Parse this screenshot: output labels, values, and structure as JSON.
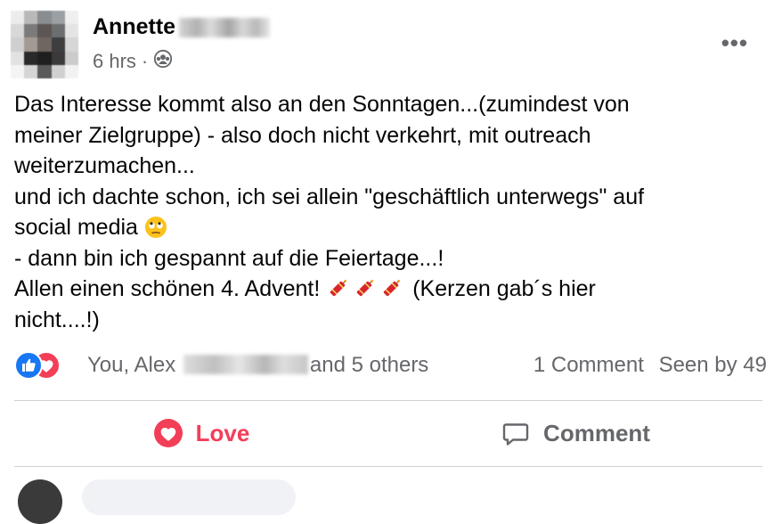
{
  "post": {
    "author_first_name": "Annette",
    "timestamp": "6 hrs",
    "separator": "·",
    "audience_icon": "friends-icon",
    "more_label": "•••",
    "text_lines": [
      "Das Interesse kommt also an den Sonntagen...(zumindest von",
      "meiner Zielgruppe) - also doch nicht verkehrt, mit outreach",
      "weiterzumachen...",
      "und ich dachte schon, ich sei allein \"geschäftlich unterwegs\" auf",
      "social media",
      "- dann bin ich gespannt auf die Feiertage...!",
      "Allen einen schönen 4. Advent!",
      "(Kerzen gab´s hier",
      "nicht....!)"
    ]
  },
  "reactions": {
    "icons": [
      "like-icon",
      "love-icon"
    ],
    "names_prefix": "You, Alex",
    "names_suffix": "and 5 others",
    "comments": "1 Comment",
    "seen_by": "Seen by 49"
  },
  "actions": {
    "love_label": "Love",
    "comment_label": "Comment"
  },
  "colors": {
    "love": "#f33e58",
    "like": "#1877f2",
    "secondary_text": "#65676b",
    "divider": "#ced0d4"
  }
}
